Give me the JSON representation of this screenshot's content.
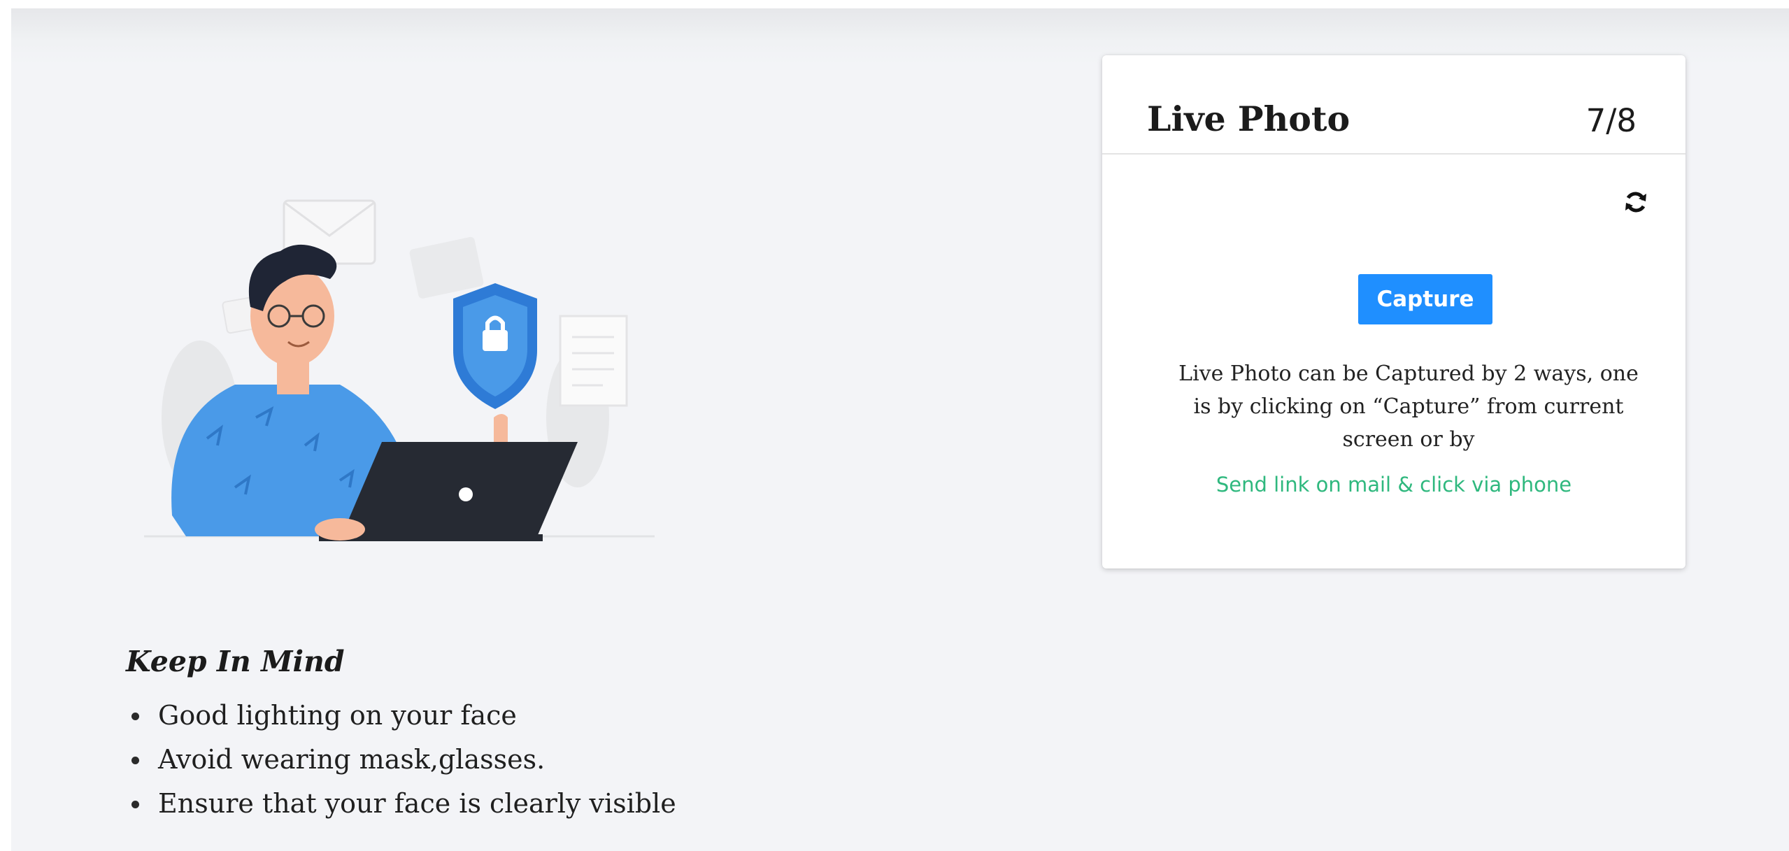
{
  "illustration": {
    "icon": "person-laptop-security-illustration",
    "colors": {
      "shirt": "#4a9ae8",
      "shield": "#2e7bd6",
      "laptop": "#262a33",
      "skin": "#f6b99b"
    }
  },
  "tips": {
    "title": "Keep In Mind",
    "items": [
      "Good lighting on your face",
      "Avoid wearing mask,glasses.",
      "Ensure that your face is clearly visible"
    ]
  },
  "card": {
    "title": "Live Photo",
    "step": "7/8",
    "refresh_icon": "refresh-icon",
    "capture_label": "Capture",
    "info_text": "Live Photo can be Captured by 2 ways, one is by clicking on “Capture” from current screen or by",
    "send_link_label": "Send link on mail & click via phone"
  },
  "colors": {
    "accent": "#1f8fff",
    "link": "#2fb87e",
    "background": "#f3f4f7"
  }
}
